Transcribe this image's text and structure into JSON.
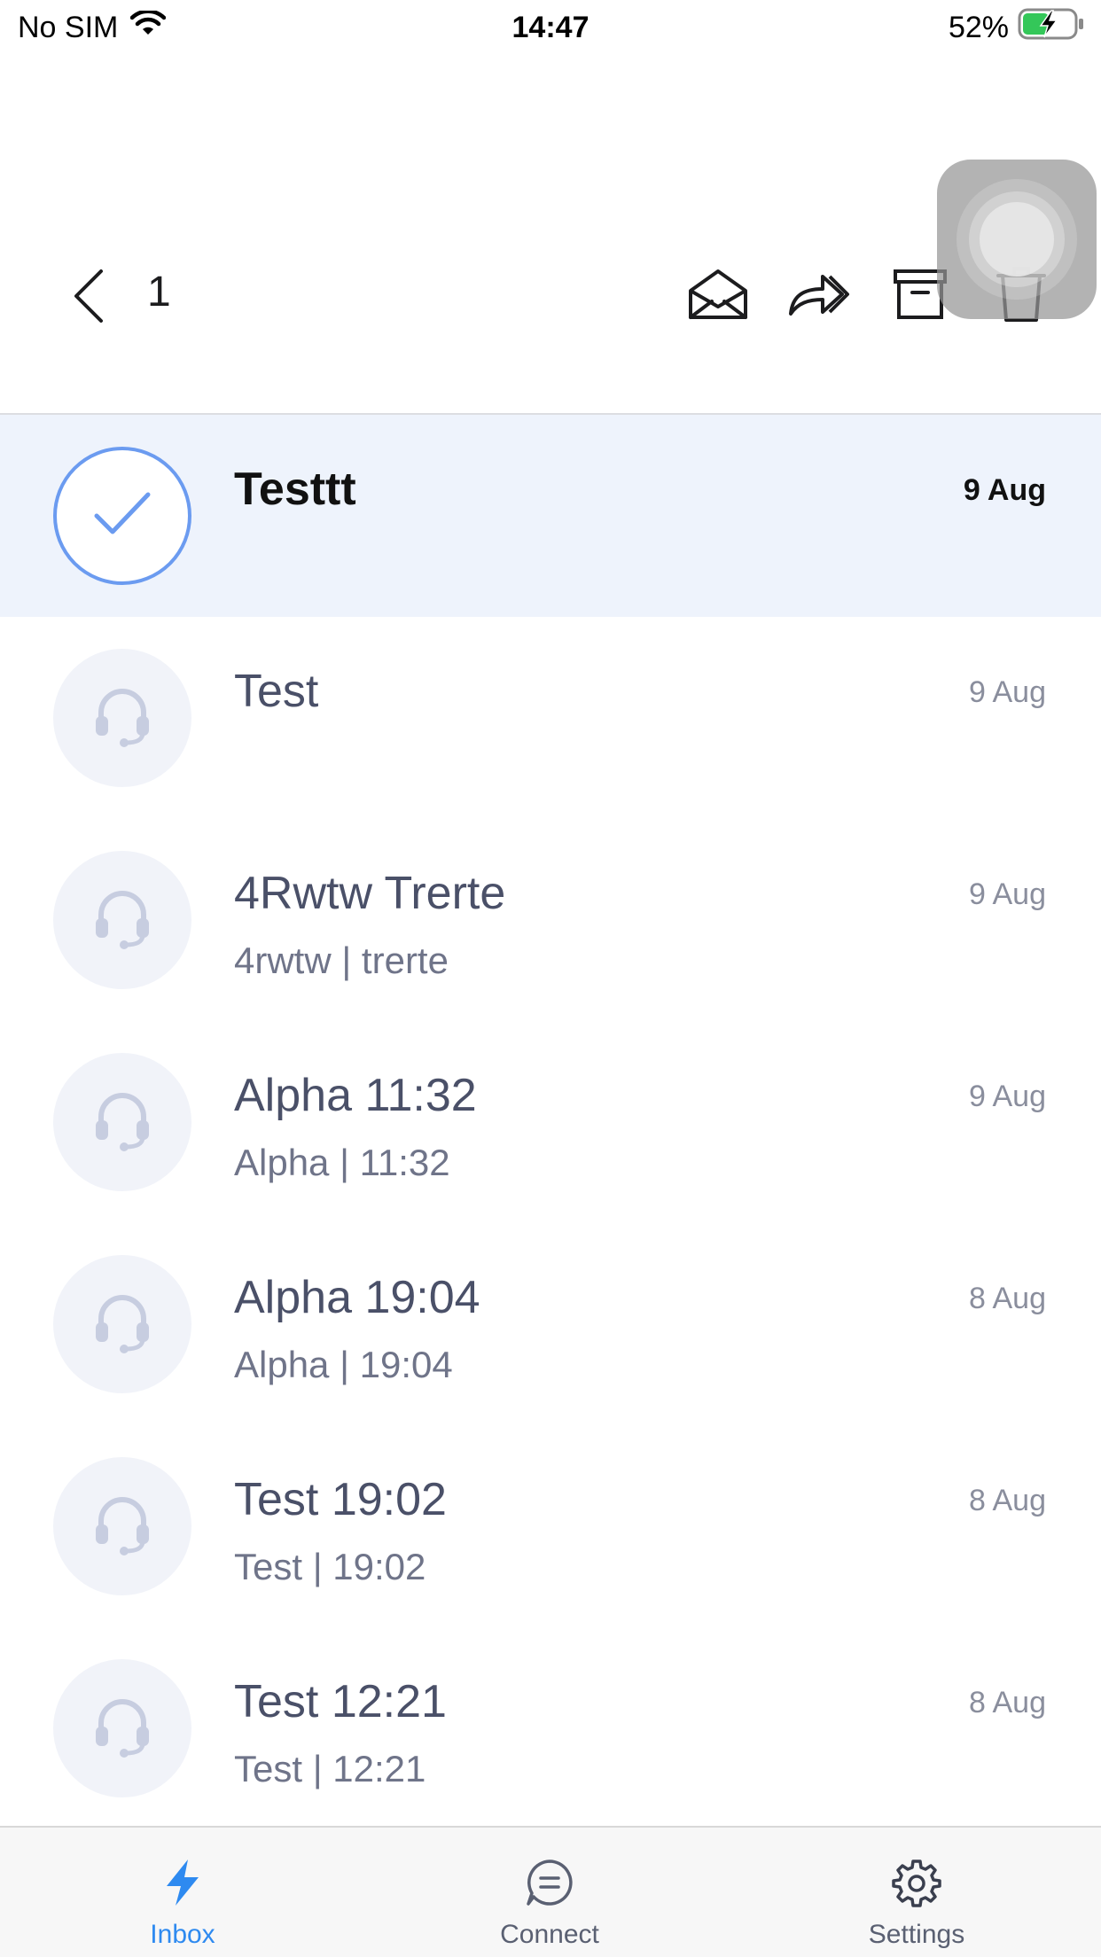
{
  "status_bar": {
    "carrier": "No SIM",
    "time": "14:47",
    "battery_percent": "52%",
    "battery_level": 0.52,
    "icons": [
      "wifi-icon",
      "battery-charging-icon"
    ]
  },
  "header": {
    "selected_count": "1",
    "actions": [
      "back-icon",
      "mark-read-icon",
      "forward-icon",
      "archive-icon",
      "trash-icon"
    ]
  },
  "conversations": [
    {
      "title": "Testtt",
      "subtitle": "",
      "date": "9 Aug",
      "selected": true
    },
    {
      "title": "Test",
      "subtitle": "",
      "date": "9 Aug",
      "selected": false
    },
    {
      "title": "4Rwtw Trerte",
      "subtitle": "4rwtw | trerte",
      "date": "9 Aug",
      "selected": false
    },
    {
      "title": "Alpha 11:32",
      "subtitle": "Alpha | 11:32",
      "date": "9 Aug",
      "selected": false
    },
    {
      "title": "Alpha 19:04",
      "subtitle": "Alpha | 19:04",
      "date": "8 Aug",
      "selected": false
    },
    {
      "title": "Test 19:02",
      "subtitle": "Test | 19:02",
      "date": "8 Aug",
      "selected": false
    },
    {
      "title": "Test 12:21",
      "subtitle": "Test | 12:21",
      "date": "8 Aug",
      "selected": false
    }
  ],
  "tabbar": {
    "tabs": [
      {
        "label": "Inbox",
        "icon": "lightning-icon",
        "active": true
      },
      {
        "label": "Connect",
        "icon": "chat-bubble-icon",
        "active": false
      },
      {
        "label": "Settings",
        "icon": "gear-icon",
        "active": false
      }
    ]
  },
  "colors": {
    "accent": "#2e8af0",
    "selected_row": "#eef3fc",
    "check_ring": "#6b9bf0",
    "avatar_bg": "#f1f3f9",
    "avatar_icon": "#c7cde0"
  }
}
